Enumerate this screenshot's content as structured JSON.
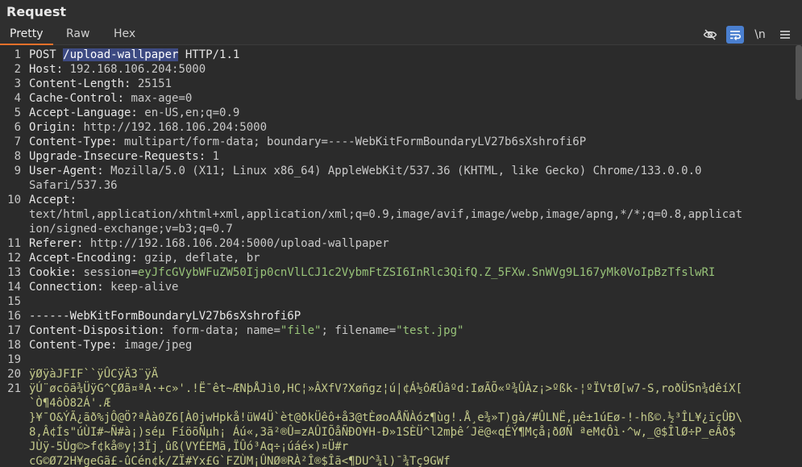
{
  "panel": {
    "title": "Request"
  },
  "tabs": [
    "Pretty",
    "Raw",
    "Hex"
  ],
  "toolbar": {
    "newline_label": "\\n"
  },
  "lines": [
    {
      "num": "1",
      "parts": [
        {
          "t": "POST ",
          "c": "k"
        },
        {
          "t": "/upload-wallpaper",
          "c": "sel"
        },
        {
          "t": " HTTP/1.1",
          "c": "k"
        }
      ]
    },
    {
      "num": "2",
      "parts": [
        {
          "t": "Host: ",
          "c": "k"
        },
        {
          "t": "192.168.106.204:5000",
          "c": "v"
        }
      ]
    },
    {
      "num": "3",
      "parts": [
        {
          "t": "Content-Length: ",
          "c": "k"
        },
        {
          "t": "25151",
          "c": "v"
        }
      ]
    },
    {
      "num": "4",
      "parts": [
        {
          "t": "Cache-Control: ",
          "c": "k"
        },
        {
          "t": "max-age=0",
          "c": "v"
        }
      ]
    },
    {
      "num": "5",
      "parts": [
        {
          "t": "Accept-Language: ",
          "c": "k"
        },
        {
          "t": "en-US,en;q=0.9",
          "c": "v"
        }
      ]
    },
    {
      "num": "6",
      "parts": [
        {
          "t": "Origin: ",
          "c": "k"
        },
        {
          "t": "http://192.168.106.204:5000",
          "c": "v"
        }
      ]
    },
    {
      "num": "7",
      "parts": [
        {
          "t": "Content-Type: ",
          "c": "k"
        },
        {
          "t": "multipart/form-data; boundary=----WebKitFormBoundaryLV27b6sXshrofi6P",
          "c": "v"
        }
      ]
    },
    {
      "num": "8",
      "parts": [
        {
          "t": "Upgrade-Insecure-Requests: ",
          "c": "k"
        },
        {
          "t": "1",
          "c": "v"
        }
      ]
    },
    {
      "num": "9",
      "parts": [
        {
          "t": "User-Agent: ",
          "c": "k"
        },
        {
          "t": "Mozilla/5.0 (X11; Linux x86_64) AppleWebKit/537.36 (KHTML, like Gecko) Chrome/133.0.0.0",
          "c": "v"
        }
      ]
    },
    {
      "num": "",
      "parts": [
        {
          "t": "Safari/537.36",
          "c": "v"
        }
      ]
    },
    {
      "num": "10",
      "parts": [
        {
          "t": "Accept:",
          "c": "k"
        }
      ]
    },
    {
      "num": "",
      "parts": [
        {
          "t": "text/html,application/xhtml+xml,application/xml;q=0.9,image/avif,image/webp,image/apng,*/*;q=0.8,applicat",
          "c": "v"
        }
      ]
    },
    {
      "num": "",
      "parts": [
        {
          "t": "ion/signed-exchange;v=b3;q=0.7",
          "c": "v"
        }
      ]
    },
    {
      "num": "11",
      "parts": [
        {
          "t": "Referer: ",
          "c": "k"
        },
        {
          "t": "http://192.168.106.204:5000/upload-wallpaper",
          "c": "v"
        }
      ]
    },
    {
      "num": "12",
      "parts": [
        {
          "t": "Accept-Encoding: ",
          "c": "k"
        },
        {
          "t": "gzip, deflate, br",
          "c": "v"
        }
      ]
    },
    {
      "num": "13",
      "parts": [
        {
          "t": "Cookie: ",
          "c": "k"
        },
        {
          "t": "session",
          "c": "v"
        },
        {
          "t": "=",
          "c": "k"
        },
        {
          "t": "eyJfcGVybWFuZW50Ijp0cnVlLCJ1c2VybmFtZSI6InRlc3QifQ.Z_5FXw.SnWVg9L167yMk0VoIpBzTfslwRI",
          "c": "s"
        }
      ]
    },
    {
      "num": "14",
      "parts": [
        {
          "t": "Connection: ",
          "c": "k"
        },
        {
          "t": "keep-alive",
          "c": "v"
        }
      ]
    },
    {
      "num": "15",
      "parts": [
        {
          "t": "",
          "c": "k"
        }
      ]
    },
    {
      "num": "16",
      "parts": [
        {
          "t": "------WebKitFormBoundaryLV27b6sXshrofi6P",
          "c": "k"
        }
      ]
    },
    {
      "num": "17",
      "parts": [
        {
          "t": "Content-Disposition: ",
          "c": "k"
        },
        {
          "t": "form-data; name=",
          "c": "v"
        },
        {
          "t": "\"file\"",
          "c": "s"
        },
        {
          "t": "; filename=",
          "c": "v"
        },
        {
          "t": "\"test.jpg\"",
          "c": "s"
        }
      ]
    },
    {
      "num": "18",
      "parts": [
        {
          "t": "Content-Type: ",
          "c": "k"
        },
        {
          "t": "image/jpeg",
          "c": "v"
        }
      ]
    },
    {
      "num": "19",
      "parts": [
        {
          "t": "",
          "c": "k"
        }
      ]
    },
    {
      "num": "20",
      "parts": [
        {
          "t": "ÿØÿàJFIF``ÿÛCÿÄ3¨ÿÄ",
          "c": "bin"
        }
      ]
    },
    {
      "num": "21",
      "parts": [
        {
          "t": "ÿÚ¨øcõã¾ÜÿG^ÇØã¤ªA·+c»'.!Ë¯êt~ÆNþÅJì0,HC¦»ÂXfV?Xøñgz¦ú|¢Á½ôÆÛâºd:IøÃÕ«º¾ÛÀz¡>ºßk-¦ºÏVtØ[w7-S,roðÜSn¾dêíX[",
          "c": "bin"
        }
      ]
    },
    {
      "num": "",
      "parts": [
        {
          "t": "`Ò¶4ôÒ82Á'.Æ",
          "c": "bin"
        }
      ]
    },
    {
      "num": "",
      "parts": [
        {
          "t": "}¥¯O&ÝÃ¿ãð%jÔ@Ö?ªÀà0Z6[À0jwHpkå!üW4Ü`èt@ðkÜêô+å3@tÈøoAÅÑÀóz¶ùg!.Å¸e¾»T)gà/#ÛLNË,µê±1úEø-!-hß©.½³ÎL¥¿ïçÛÐ\\",
          "c": "bin"
        }
      ]
    },
    {
      "num": "",
      "parts": [
        {
          "t": "8,Â¢Ís\"úÙI#~Ñ#à¡)séµ FíöõÑµh¡ Áú«,3ã²®Û=zAÛIÕåÑÐO¥H-Ð»1SÈÜ^l2mþê´Jë@«qÉÝ¶Mçå¡ðØÑ ªeM¢Ôì·^w,_@$ÎlØ÷P_eÂð$",
          "c": "bin"
        }
      ]
    },
    {
      "num": "",
      "parts": [
        {
          "t": "JÙÿ-5Ùg©>f¢kå®y¦3Ïj¸ûß(VYÉEMã,ÏÛó³Aq÷¡úáé×)¤Ü#r",
          "c": "bin"
        }
      ]
    },
    {
      "num": "",
      "parts": [
        {
          "t": "cG©Ø72H¥geGã£-ûCén¢k/ZÏ#Yx£G`FZÙM¡ÛNØ®RÀ²Î®$Îã<¶DU^¾l)¯¾Tç9GWf",
          "c": "bin"
        }
      ]
    }
  ]
}
